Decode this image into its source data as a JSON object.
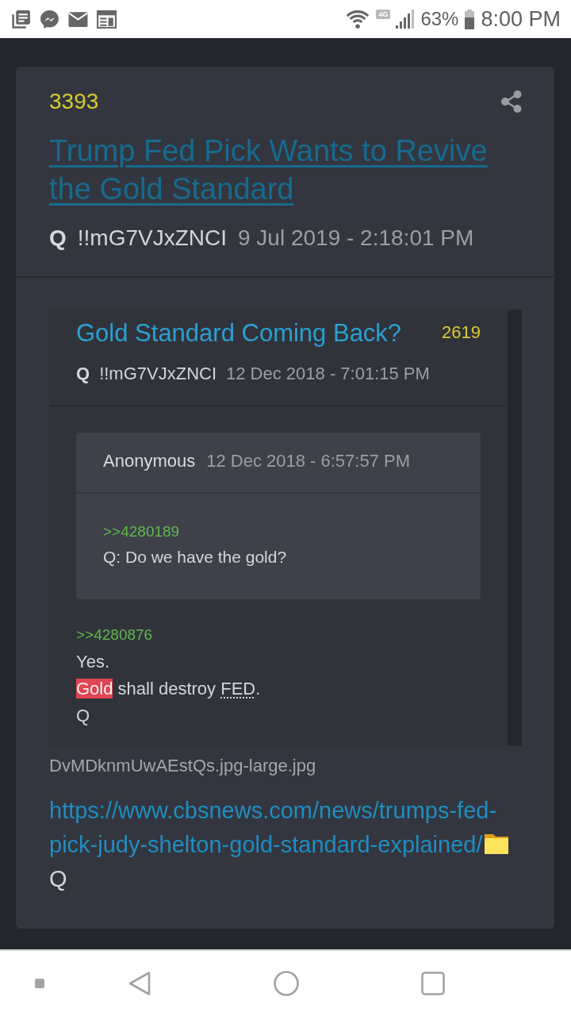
{
  "status_bar": {
    "network_badge": "4G",
    "battery": "63%",
    "time": "8:00 PM"
  },
  "post": {
    "number": "3393",
    "title": "Trump Fed Pick Wants to Revive the Gold Standard",
    "author": "Q",
    "tripcode": "!!mG7VJxZNCI",
    "timestamp": "9 Jul 2019 - 2:18:01 PM",
    "quoted_post": {
      "title": "Gold Standard Coming Back?",
      "number": "2619",
      "author": "Q",
      "tripcode": "!!mG7VJxZNCI",
      "timestamp": "12 Dec 2018 - 7:01:15 PM",
      "quoted_reply": {
        "author": "Anonymous",
        "timestamp": "12 Dec 2018 - 6:57:57 PM",
        "lines": [
          {
            "kind": "reference",
            "text": ">>4280189"
          },
          {
            "kind": "text",
            "text": "Q: Do we have the gold?"
          }
        ]
      },
      "lines": [
        {
          "kind": "reference",
          "text": ">>4280876"
        },
        {
          "kind": "text",
          "text": "Yes."
        },
        {
          "kind": "marked",
          "segments": [
            {
              "text": "Gold",
              "highlighted": true,
              "abbreviation": false
            },
            {
              "text": " shall destroy ",
              "highlighted": false,
              "abbreviation": false
            },
            {
              "text": "FED",
              "highlighted": false,
              "abbreviation": true
            },
            {
              "text": ".",
              "highlighted": false,
              "abbreviation": false
            }
          ]
        },
        {
          "kind": "text",
          "text": "Q"
        }
      ]
    },
    "attachment": "DvMDknmUwAEstQs.jpg-large.jpg",
    "lines": [
      {
        "kind": "link",
        "text": "https://www.cbsnews.com/news/trumps-fed-pick-judy-shelton-gold-standard-explained/"
      },
      {
        "kind": "text",
        "text": "Q"
      }
    ]
  }
}
